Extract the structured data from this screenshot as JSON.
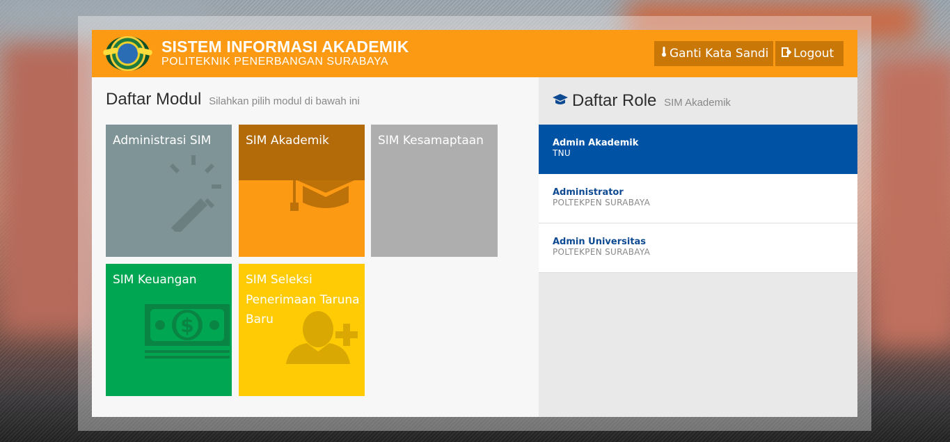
{
  "header": {
    "title": "SISTEM INFORMASI AKADEMIK",
    "subtitle": "POLITEKNIK PENERBANGAN SURABAYA",
    "change_password_label": "Ganti Kata Sandi",
    "logout_label": "Logout",
    "accent_color": "#fd9a13"
  },
  "modules": {
    "heading": "Daftar Modul",
    "subheading": "Silahkan pilih modul di bawah ini",
    "items": [
      {
        "label": "Administrasi SIM",
        "icon": "magic-wand-icon",
        "color": "#7f9496"
      },
      {
        "label": "SIM Akademik",
        "icon": "graduation-cap-icon",
        "color": "#fd9a13"
      },
      {
        "label": "SIM Kesamaptaan",
        "icon": "",
        "color": "#aeaeae"
      },
      {
        "label": "SIM Keuangan",
        "icon": "money-icon",
        "color": "#00a652"
      },
      {
        "label": "SIM Seleksi Penerimaan Taruna Baru",
        "icon": "add-user-icon",
        "color": "#ffcb05"
      }
    ]
  },
  "roles": {
    "heading": "Daftar Role",
    "subheading": "SIM Akademik",
    "items": [
      {
        "name": "Admin Akademik",
        "unit": "TNU",
        "active": true
      },
      {
        "name": "Administrator",
        "unit": "POLTEKPEN SURABAYA",
        "active": false
      },
      {
        "name": "Admin Universitas",
        "unit": "POLTEKPEN SURABAYA",
        "active": false
      }
    ],
    "active_color": "#0052a4"
  }
}
